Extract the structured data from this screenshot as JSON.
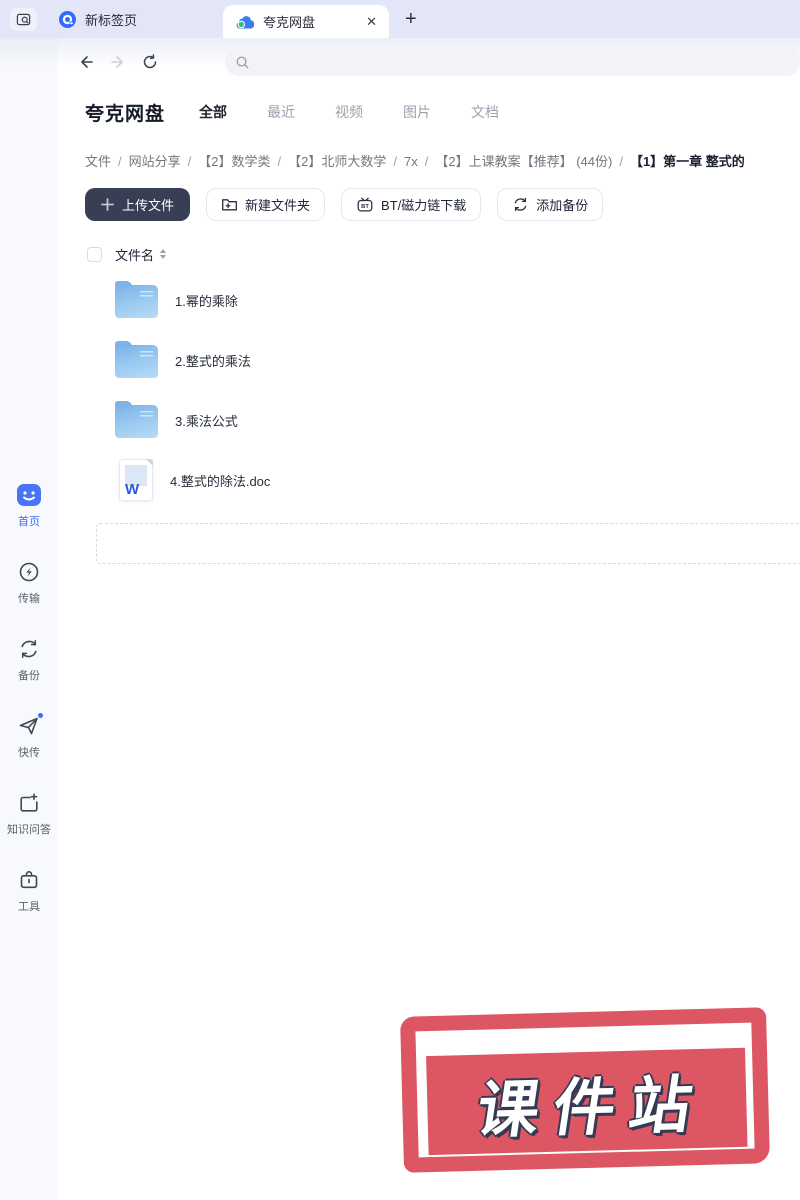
{
  "browser": {
    "tabs": [
      {
        "label": "新标签页",
        "active": false
      },
      {
        "label": "夸克网盘",
        "active": true
      }
    ],
    "close_label": "✕",
    "new_tab_label": "+"
  },
  "navbar": {
    "search_placeholder": "",
    "icons": [
      "tab-overview-icon",
      "back-icon",
      "forward-icon",
      "refresh-icon",
      "search-icon"
    ]
  },
  "drive": {
    "title": "夸克网盘",
    "filter_tabs": [
      {
        "label": "全部",
        "active": true
      },
      {
        "label": "最近",
        "active": false
      },
      {
        "label": "视频",
        "active": false
      },
      {
        "label": "图片",
        "active": false
      },
      {
        "label": "文档",
        "active": false
      }
    ]
  },
  "breadcrumb": {
    "separator": "/",
    "items": [
      "文件",
      "网站分享",
      "【2】数学类",
      "【2】北师大数学",
      "7x",
      "【2】上课教案【推荐】 (44份)"
    ],
    "current": "【1】第一章 整式的"
  },
  "toolbar": {
    "upload_label": "上传文件",
    "new_folder_label": "新建文件夹",
    "bt_label": "BT/磁力链下载",
    "bt_icon_text": "BT",
    "backup_label": "添加备份"
  },
  "file_list": {
    "name_header": "文件名",
    "doc_letter": "W",
    "rows": [
      {
        "name": "1.幂的乘除",
        "type": "folder"
      },
      {
        "name": "2.整式的乘法",
        "type": "folder"
      },
      {
        "name": "3.乘法公式",
        "type": "folder"
      },
      {
        "name": "4.整式的除法.doc",
        "type": "doc"
      }
    ]
  },
  "sidebar": {
    "items": [
      {
        "label": "首页",
        "active": true
      },
      {
        "label": "传输",
        "active": false
      },
      {
        "label": "备份",
        "active": false
      },
      {
        "label": "快传",
        "active": false,
        "badge": true
      },
      {
        "label": "知识问答",
        "active": false
      },
      {
        "label": "工具",
        "active": false
      }
    ]
  },
  "stamp": {
    "text": "课件站",
    "color": "#dc5763"
  },
  "colors": {
    "accent_blue": "#3f6bf5",
    "tabbar_bg": "#e3e6f6",
    "dark_button": "#383e54",
    "folder_blue": "#8ec0ec",
    "stamp_red": "#dc5763"
  }
}
